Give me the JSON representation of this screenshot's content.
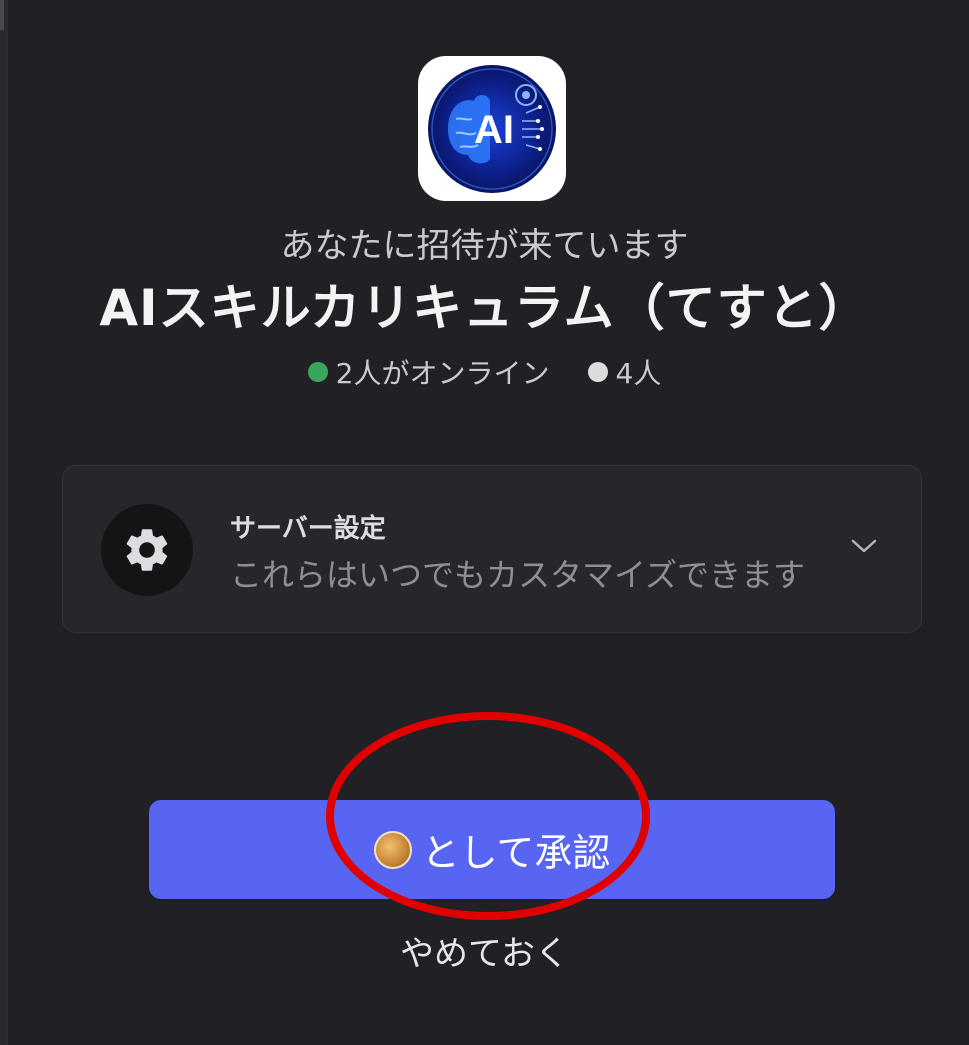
{
  "invite": {
    "heading": "あなたに招待が来ています",
    "server_name": "AIスキルカリキュラム（てすと）",
    "server_icon_text": "AI",
    "online_count": "2人がオンライン",
    "member_count": "4人"
  },
  "settings": {
    "title": "サーバー設定",
    "subtitle": "これらはいつでもカスタマイズできます"
  },
  "actions": {
    "accept_label": "として承認",
    "cancel_label": "やめておく"
  },
  "colors": {
    "accent": "#5865f2",
    "online": "#3ba55d",
    "highlight": "#e10000"
  }
}
